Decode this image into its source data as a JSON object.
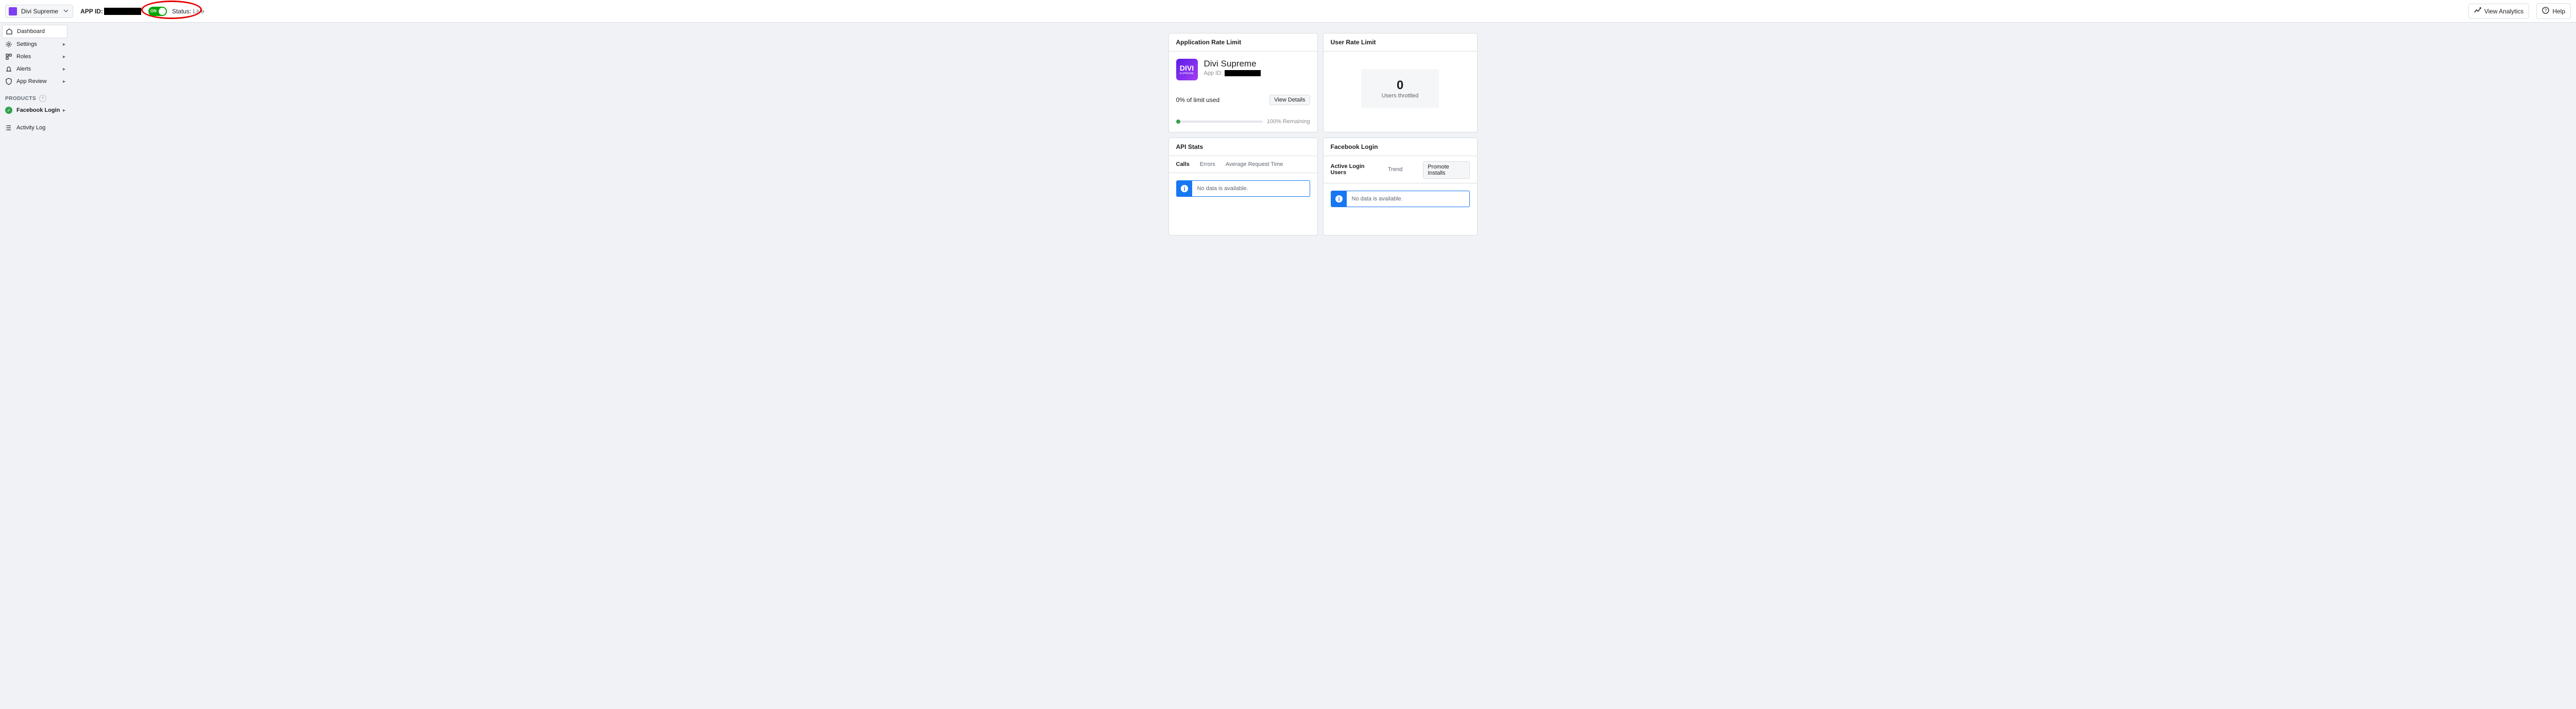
{
  "topbar": {
    "app_name": "Divi Supreme",
    "app_id_label": "APP ID:",
    "toggle_on": "ON",
    "status_prefix": "Status: ",
    "status_value": "Live",
    "view_analytics": "View Analytics",
    "help": "Help"
  },
  "sidebar": {
    "dashboard": "Dashboard",
    "settings": "Settings",
    "roles": "Roles",
    "alerts": "Alerts",
    "app_review": "App Review",
    "products_label": "PRODUCTS",
    "facebook_login": "Facebook Login",
    "activity_log": "Activity Log"
  },
  "cards": {
    "rate_limit": {
      "title": "Application Rate Limit",
      "app_name": "Divi Supreme",
      "app_id_label": "App ID:",
      "limit_used": "0% of limit used",
      "view_details": "View Details",
      "remaining": "100% Remaining",
      "brand_top": "DIVI",
      "brand_bottom": "SUPREME"
    },
    "user_rate_limit": {
      "title": "User Rate Limit",
      "number": "0",
      "label": "Users throttled"
    },
    "api_stats": {
      "title": "API Stats",
      "tabs": {
        "calls": "Calls",
        "errors": "Errors",
        "art": "Average Request Time"
      },
      "no_data": "No data is available."
    },
    "facebook_login": {
      "title": "Facebook Login",
      "tabs": {
        "active": "Active Login Users",
        "trend": "Trend"
      },
      "promote": "Promote Installs",
      "no_data": "No data is available."
    }
  }
}
